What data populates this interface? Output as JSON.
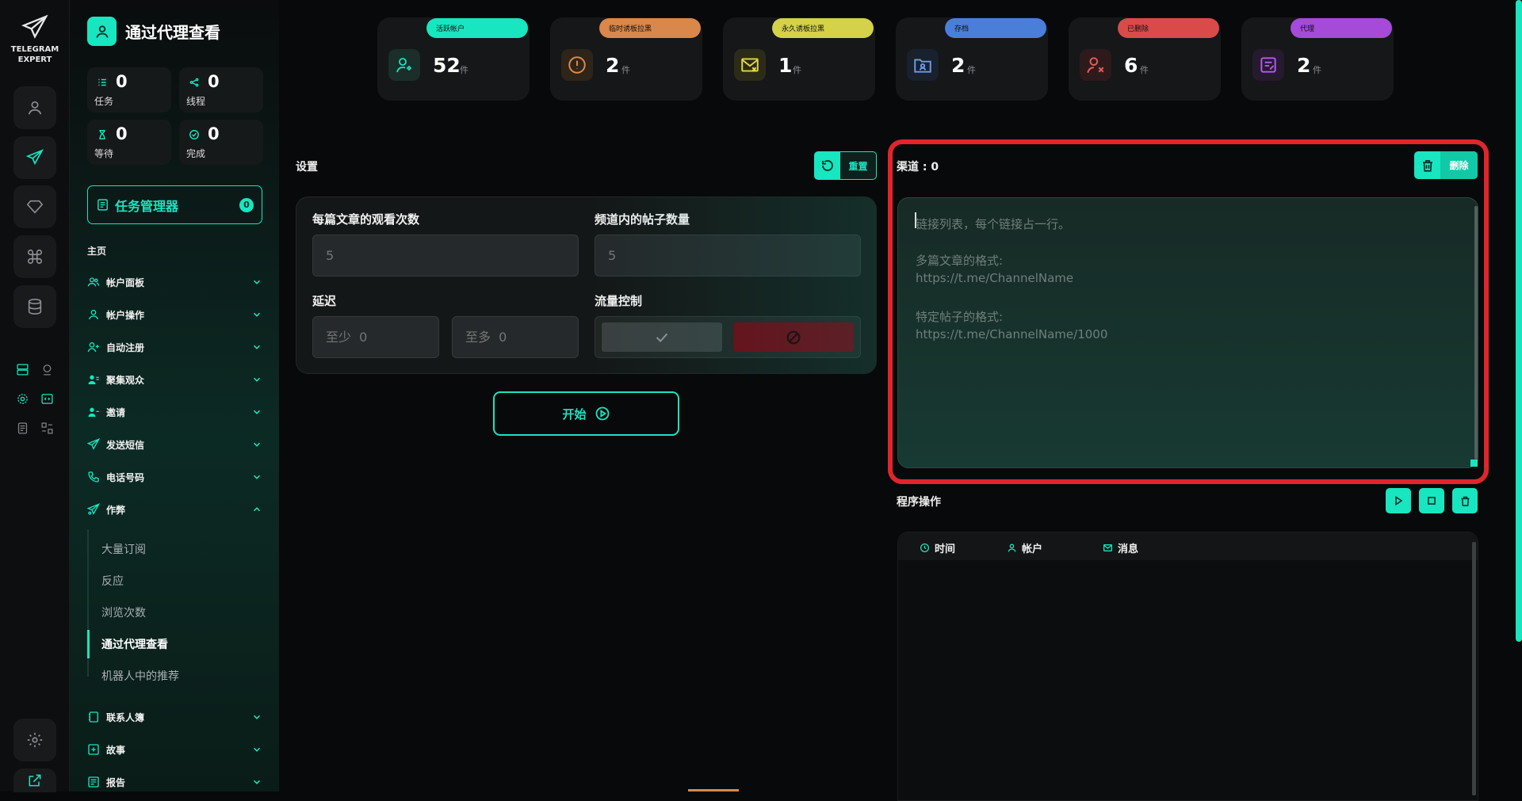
{
  "app": {
    "logo_line1": "TELEGRAM",
    "logo_line2": "EXPERT"
  },
  "sidebar": {
    "title": "通过代理查看",
    "stats": [
      {
        "icon": "list-icon",
        "value": "0",
        "label": "任务"
      },
      {
        "icon": "share-icon",
        "value": "0",
        "label": "线程"
      },
      {
        "icon": "hourglass-icon",
        "value": "0",
        "label": "等待"
      },
      {
        "icon": "check-circle-icon",
        "value": "0",
        "label": "完成"
      }
    ],
    "task_manager": {
      "label": "任务管理器",
      "badge": "0"
    },
    "section": "主页",
    "nav": [
      {
        "label": "帐户面板",
        "icon": "users-icon"
      },
      {
        "label": "帐户操作",
        "icon": "user-icon"
      },
      {
        "label": "自动注册",
        "icon": "user-plus-icon"
      },
      {
        "label": "聚集观众",
        "icon": "users-gather-icon"
      },
      {
        "label": "邀请",
        "icon": "users-invite-icon"
      },
      {
        "label": "发送短信",
        "icon": "send-icon"
      },
      {
        "label": "电话号码",
        "icon": "phone-icon"
      },
      {
        "label": "作弊",
        "icon": "send-cheat-icon"
      }
    ],
    "sub": [
      "大量订阅",
      "反应",
      "浏览次数",
      "通过代理查看",
      "机器人中的推荐"
    ],
    "nav_bottom": [
      {
        "label": "联系人簿",
        "icon": "contacts-icon"
      },
      {
        "label": "故事",
        "icon": "story-icon"
      },
      {
        "label": "报告",
        "icon": "report-icon"
      }
    ]
  },
  "cards": [
    {
      "tag": "活跃帐户",
      "value": "52",
      "unit": "件",
      "color": "#17e6c0",
      "icon": "user-heart-icon"
    },
    {
      "tag": "临时诱板拉黑",
      "value": "2",
      "unit": "件",
      "color": "#d9874a",
      "icon": "alert-circle-icon"
    },
    {
      "tag": "永久诱板拉黑",
      "value": "1",
      "unit": "件",
      "color": "#d4d14a",
      "icon": "mail-x-icon"
    },
    {
      "tag": "存档",
      "value": "2",
      "unit": "件",
      "color": "#4a7fd9",
      "icon": "folder-user-icon"
    },
    {
      "tag": "已删除",
      "value": "6",
      "unit": "件",
      "color": "#d94a4a",
      "icon": "user-x-icon"
    },
    {
      "tag": "代理",
      "value": "2",
      "unit": "件",
      "color": "#a54ad9",
      "icon": "proxy-icon"
    }
  ],
  "settings": {
    "title": "设置",
    "reset": "重置",
    "views_per_post": {
      "label": "每篇文章的观看次数",
      "placeholder": "5"
    },
    "posts_in_channel": {
      "label": "频道内的帖子数量",
      "placeholder": "5"
    },
    "delay": {
      "label": "延迟",
      "min_placeholder": "至少  0",
      "max_placeholder": "至多  0"
    },
    "flow_control": {
      "label": "流量控制"
    },
    "start": "开始"
  },
  "channels": {
    "title": "渠道 : 0",
    "delete": "删除",
    "placeholder_lines": [
      "链接列表，每个链接占一行。",
      "多篇文章的格式:",
      "https://t.me/ChannelName",
      "特定帖子的格式:",
      "https://t.me/ChannelName/1000"
    ]
  },
  "log": {
    "title": "程序操作",
    "columns": [
      "时间",
      "帐户",
      "消息"
    ]
  },
  "colors": {
    "accent": "#17e6c0",
    "highlight": "#e1252b"
  }
}
